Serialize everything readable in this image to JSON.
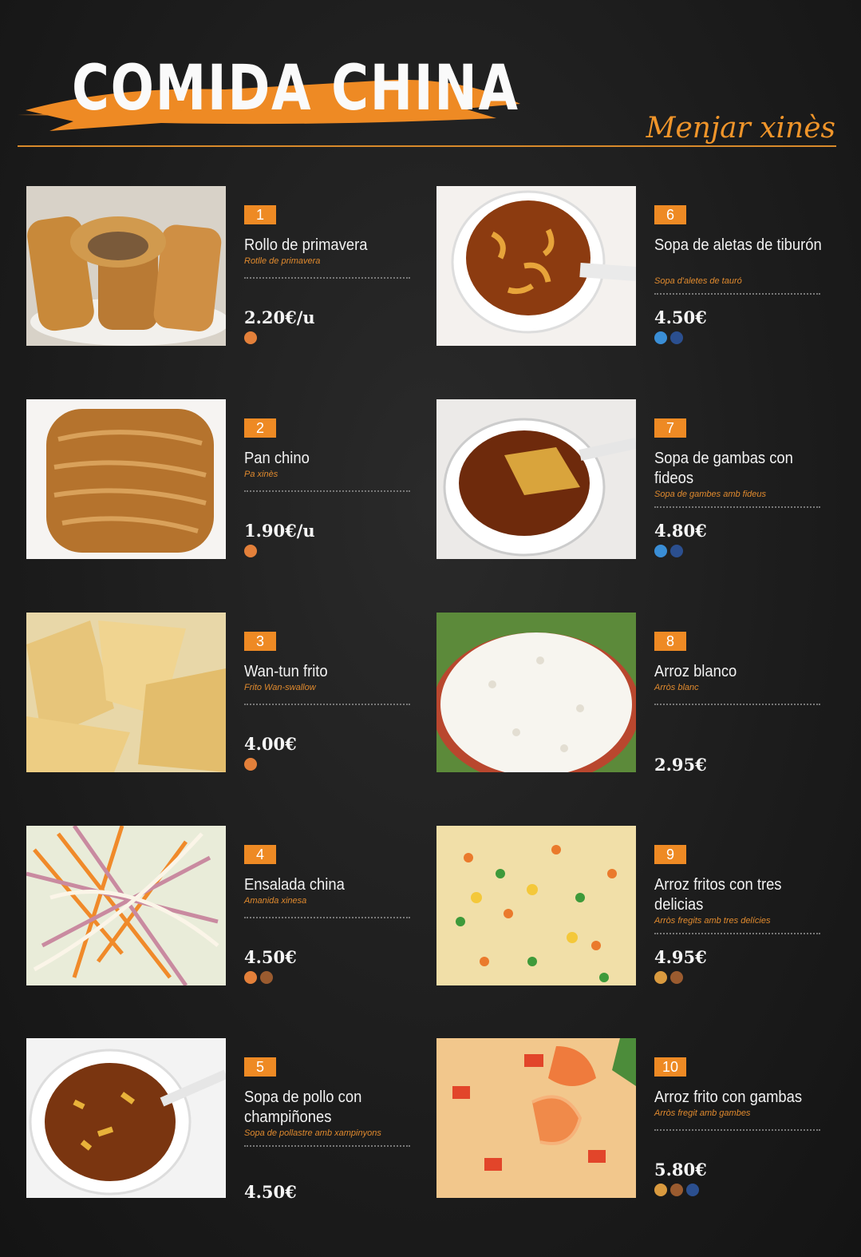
{
  "header": {
    "title": "COMIDA CHINA",
    "subtitle": "Menjar xinès",
    "accent_color": "#ee8a24"
  },
  "items": [
    {
      "number": "1",
      "name": "Rollo de primavera",
      "translation": "Rotlle de primavera",
      "price": "2.20€/u",
      "allergens": [
        "gluten-icon"
      ],
      "photo": "spring-roll-photo"
    },
    {
      "number": "2",
      "name": "Pan chino",
      "translation": "Pa xinès",
      "price": "1.90€/u",
      "allergens": [
        "gluten-icon"
      ],
      "photo": "chinese-bread-photo"
    },
    {
      "number": "3",
      "name": "Wan-tun frito",
      "translation": "Frito Wan-swallow",
      "price": "4.00€",
      "allergens": [
        "gluten-icon"
      ],
      "photo": "fried-wonton-photo"
    },
    {
      "number": "4",
      "name": "Ensalada china",
      "translation": "Amanida xinesa",
      "price": "4.50€",
      "allergens": [
        "gluten-icon",
        "egg-icon"
      ],
      "photo": "chinese-salad-photo"
    },
    {
      "number": "5",
      "name": "Sopa de pollo con champiñones",
      "translation": "Sopa de pollastre amb xampinyons",
      "price": "4.50€",
      "allergens": [],
      "photo": "chicken-soup-photo"
    },
    {
      "number": "6",
      "name": "Sopa de aletas de tiburón",
      "translation": "Sopa d'aletes de tauró",
      "price": "4.50€",
      "allergens": [
        "crustacean-icon",
        "fish-icon"
      ],
      "photo": "shark-fin-soup-photo"
    },
    {
      "number": "7",
      "name": "Sopa de gambas con fideos",
      "translation": "Sopa de gambes amb fideus",
      "price": "4.80€",
      "allergens": [
        "crustacean-icon",
        "fish-icon"
      ],
      "photo": "shrimp-noodle-soup-photo"
    },
    {
      "number": "8",
      "name": "Arroz blanco",
      "translation": "Arròs blanc",
      "price": "2.95€",
      "allergens": [],
      "photo": "white-rice-photo"
    },
    {
      "number": "9",
      "name": "Arroz fritos con tres delicias",
      "translation": "Arròs fregits amb tres delícies",
      "price": "4.95€",
      "allergens": [
        "dairy-icon",
        "egg-icon"
      ],
      "photo": "three-delights-rice-photo"
    },
    {
      "number": "10",
      "name": "Arroz frito con gambas",
      "translation": "Arròs fregit amb gambes",
      "price": "5.80€",
      "allergens": [
        "dairy-icon",
        "egg-icon",
        "fish-icon"
      ],
      "photo": "shrimp-fried-rice-photo"
    }
  ]
}
